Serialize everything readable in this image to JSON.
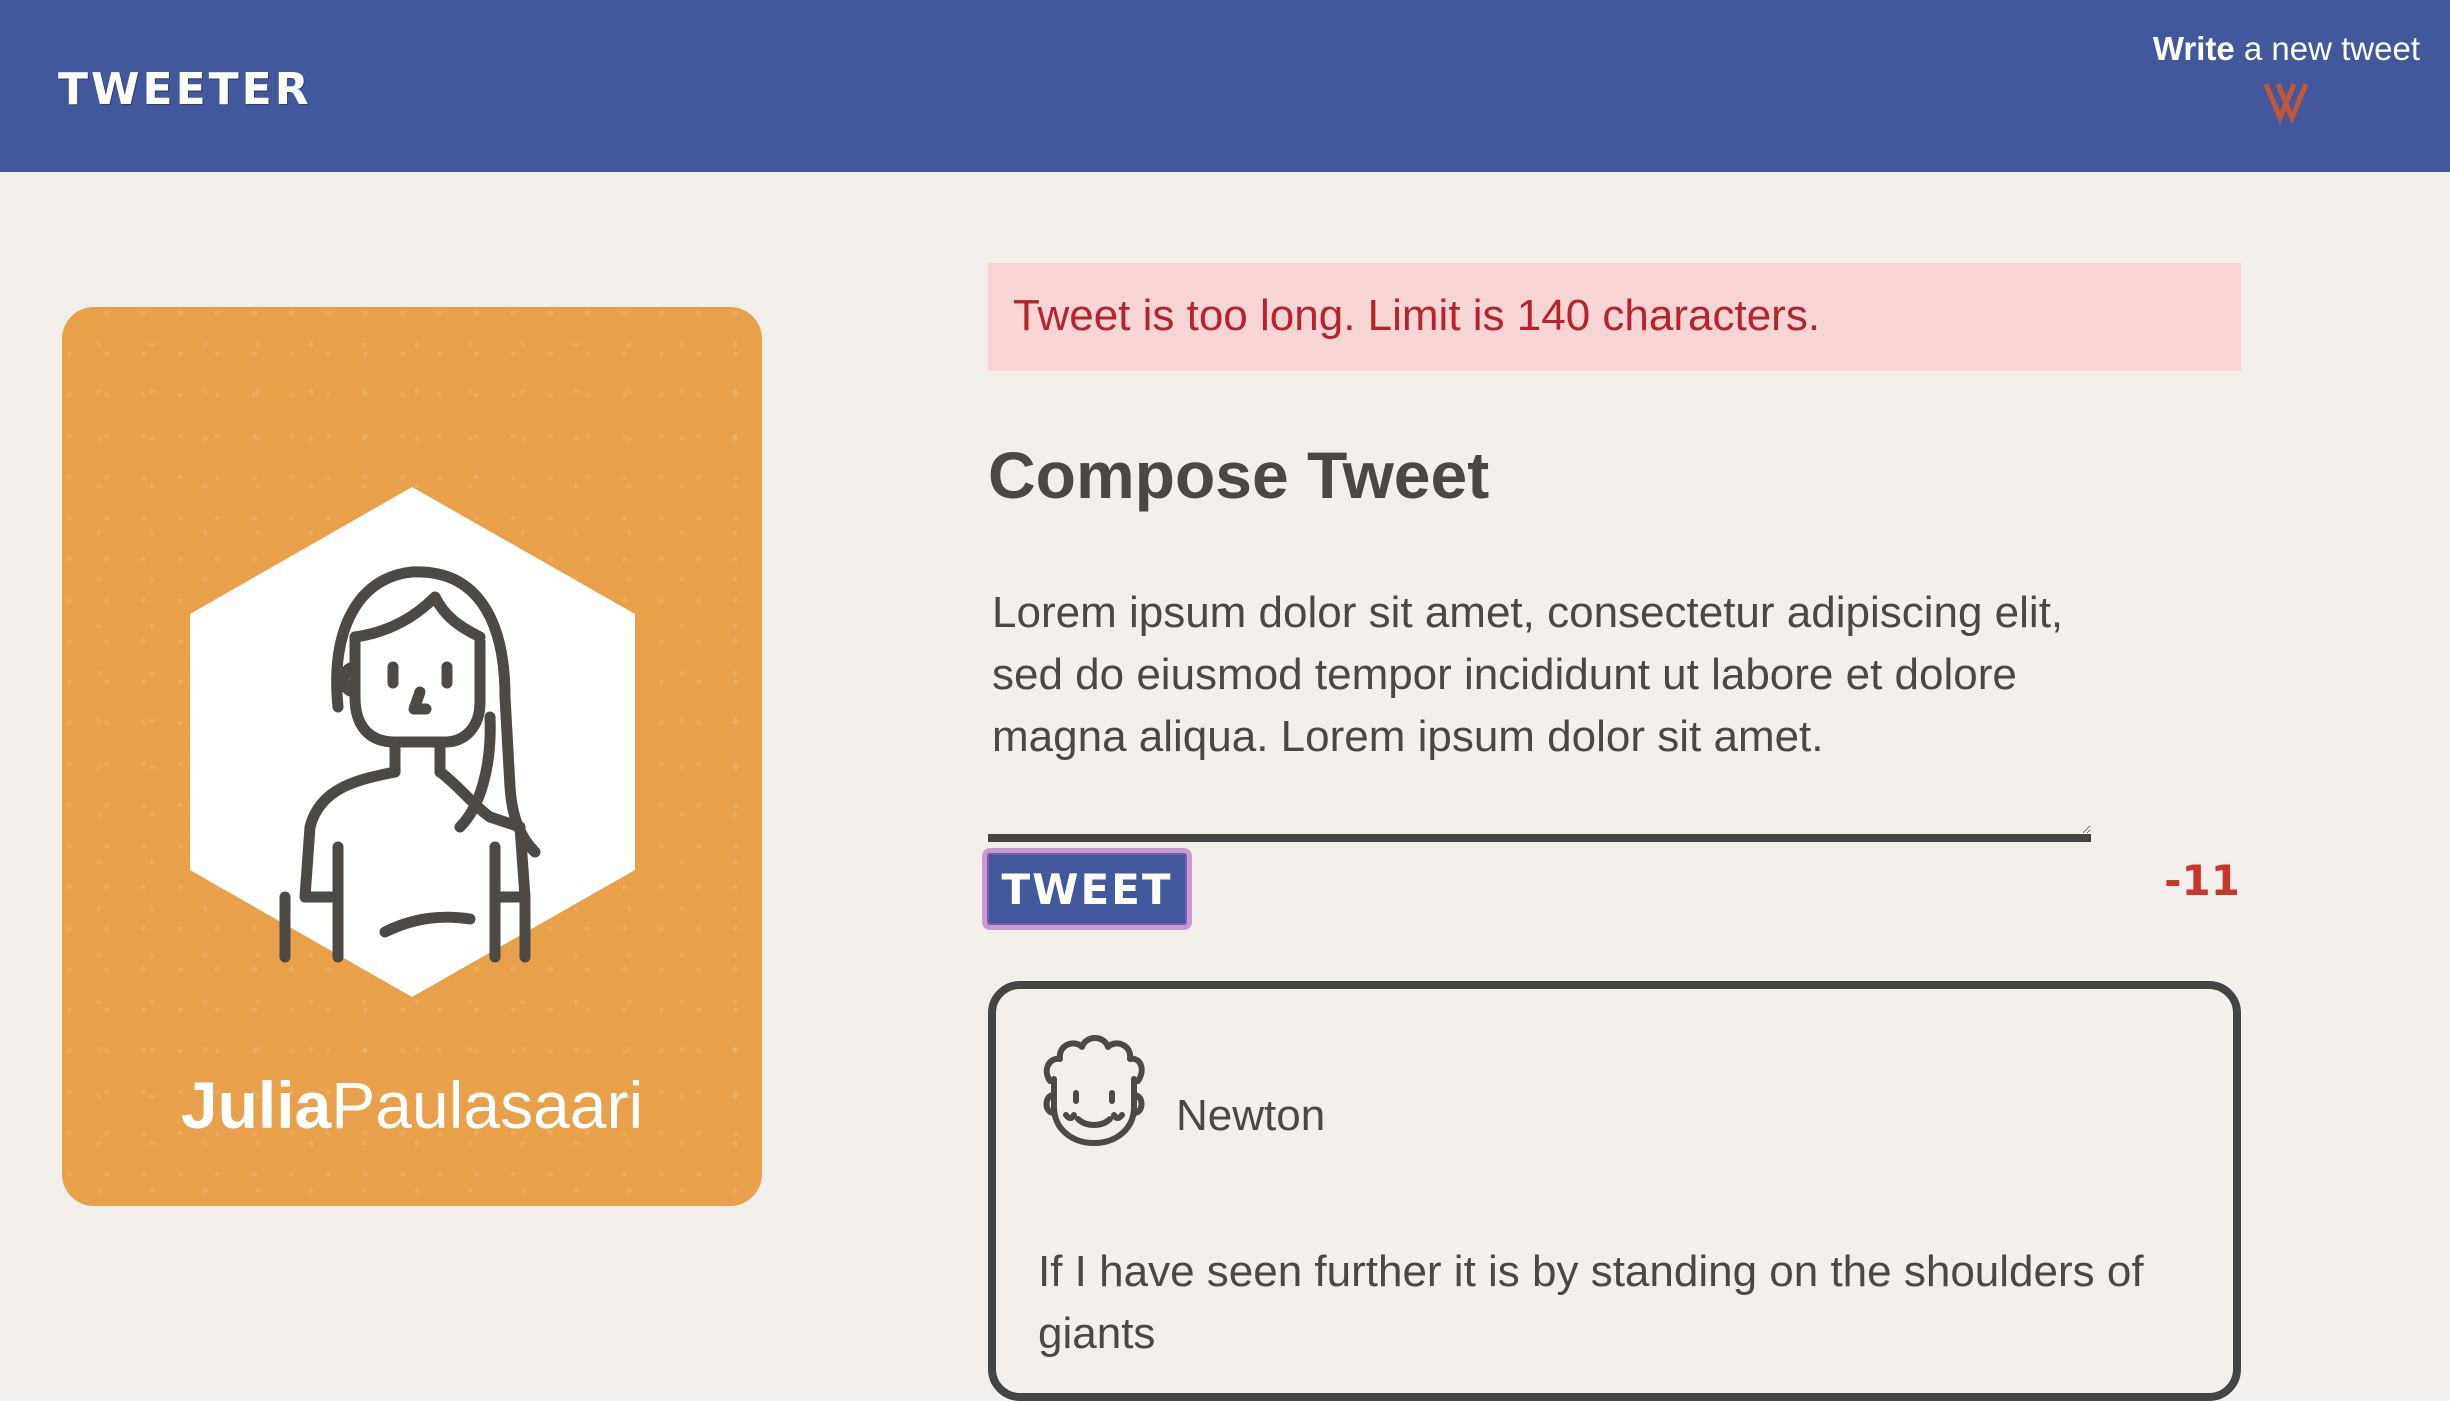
{
  "nav": {
    "brand": "TWEETER",
    "compose_bold": "Write",
    "compose_rest": " a new tweet",
    "compose_icon": "double-chevron-down-icon"
  },
  "profile": {
    "first_name": "Julia",
    "last_name": "Paulasaari",
    "avatar_icon": "woman-avatar-icon",
    "card_color": "#e8a04b"
  },
  "compose": {
    "error": "Tweet is too long. Limit is 140 characters.",
    "title": "Compose Tweet",
    "text": "Lorem ipsum dolor sit amet, consectetur adipiscing elit, sed do eiusmod tempor incididunt ut labore et dolore magna aliqua. Lorem ipsum dolor sit amet.",
    "button_label": "TWEET",
    "counter": "-11"
  },
  "tweets": [
    {
      "user": "Newton",
      "avatar_icon": "newton-avatar-icon",
      "content": "If I have seen further it is by standing on the shoulders of giants"
    }
  ],
  "colors": {
    "nav": "#42579c",
    "background": "#f3f0ec",
    "error_bg": "#f6d5d4",
    "error_text": "#b6242b",
    "counter": "#c8362a",
    "accent_chevron": "#c0563a"
  }
}
